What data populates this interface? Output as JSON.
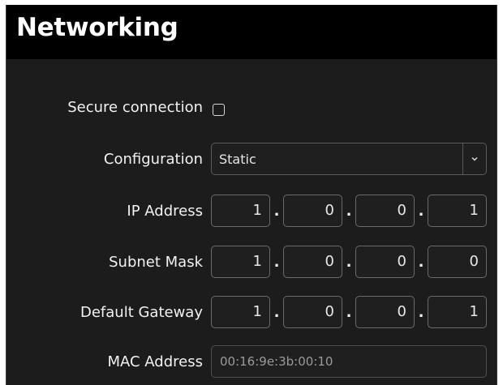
{
  "window": {
    "title": "Networking"
  },
  "form": {
    "secure_connection_label": "Secure connection",
    "secure_connection_checked": false,
    "configuration_label": "Configuration",
    "configuration_value": "Static",
    "ip_label": "IP Address",
    "ip_octets": [
      "1",
      "0",
      "0",
      "1"
    ],
    "subnet_label": "Subnet Mask",
    "subnet_octets": [
      "1",
      "0",
      "0",
      "0"
    ],
    "gateway_label": "Default Gateway",
    "gateway_octets": [
      "1",
      "0",
      "0",
      "1"
    ],
    "mac_label": "MAC Address",
    "mac_value": "00:16:9e:3b:00:10",
    "separator": "."
  },
  "icons": {
    "dropdown": "chevron-down-icon"
  },
  "colors": {
    "background": "#1c1c1c",
    "header": "#000000",
    "text": "#f2f2f2",
    "field_border": "#6a6a6a",
    "placeholder_text": "#9a9a9a"
  }
}
